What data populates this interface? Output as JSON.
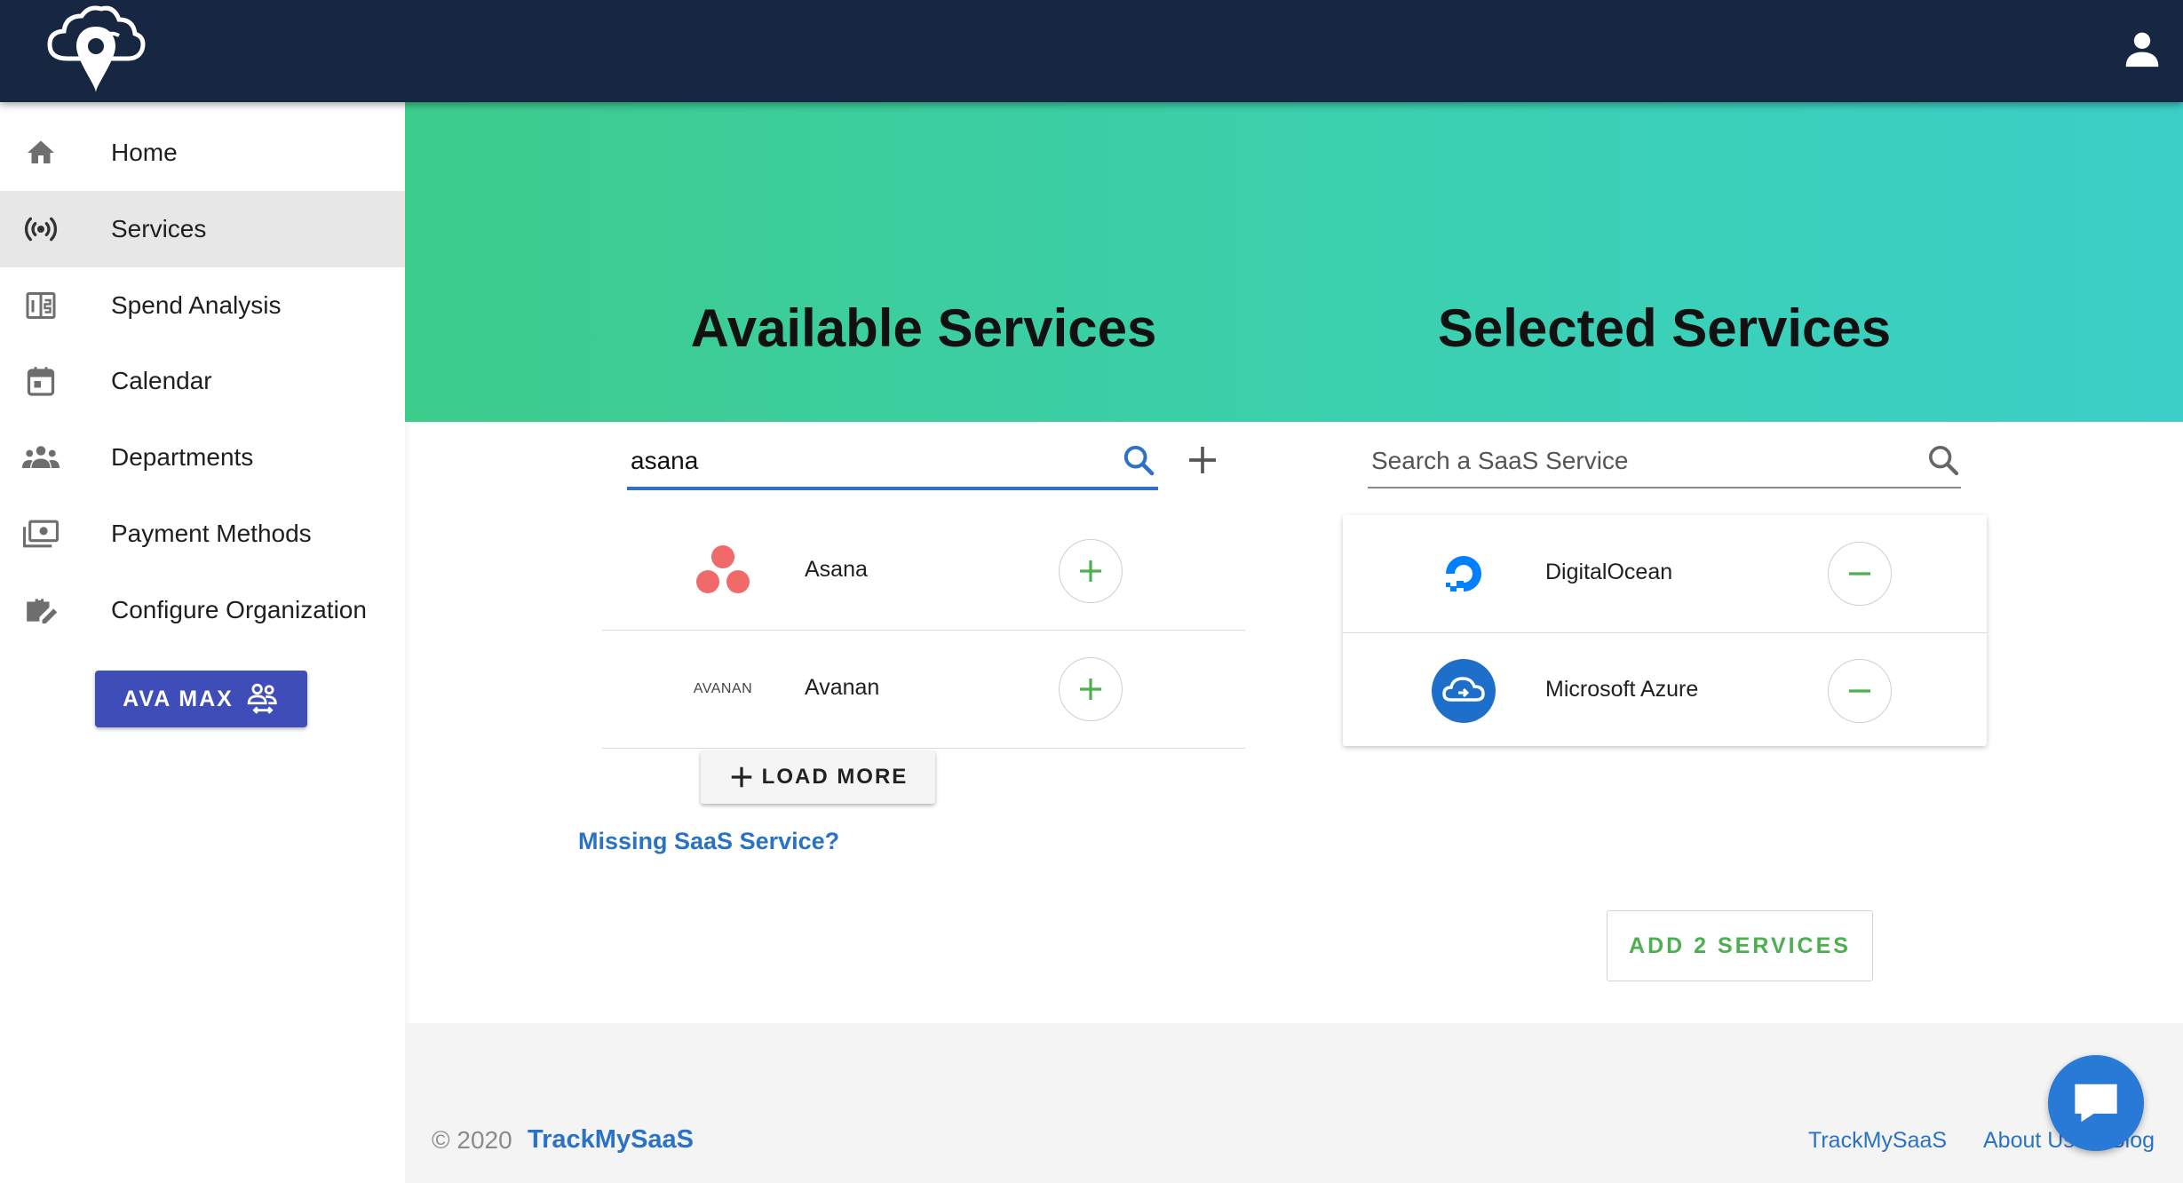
{
  "header": {
    "logo_icon": "cloud-location-logo-icon",
    "user_icon": "user-account-icon",
    "bar_color": "#172641"
  },
  "sidebar": {
    "items": [
      {
        "label": "Home",
        "icon": "home-icon"
      },
      {
        "label": "Services",
        "icon": "broadcast-icon",
        "active": true
      },
      {
        "label": "Spend Analysis",
        "icon": "analysis-icon"
      },
      {
        "label": "Calendar",
        "icon": "calendar-icon"
      },
      {
        "label": "Departments",
        "icon": "people-icon"
      },
      {
        "label": "Payment Methods",
        "icon": "payment-icon"
      },
      {
        "label": "Configure Organization",
        "icon": "briefcase-edit-icon"
      }
    ],
    "ava_button": {
      "label": "AVA MAX",
      "icon": "people-swap-icon",
      "color": "#3f4db8"
    }
  },
  "hero": {
    "available_title": "Available Services",
    "selected_title": "Selected Services"
  },
  "available": {
    "search_value": "asana",
    "services": [
      {
        "name": "Asana",
        "logo_text": ""
      },
      {
        "name": "Avanan",
        "logo_text": "AVANAN"
      }
    ],
    "load_more_label": "LOAD MORE",
    "missing_link": "Missing SaaS Service?"
  },
  "selected": {
    "search_placeholder": "Search a SaaS Service",
    "services": [
      {
        "name": "DigitalOcean"
      },
      {
        "name": "Microsoft Azure"
      }
    ],
    "add_button_label": "ADD 2 SERVICES"
  },
  "footer": {
    "copyright": "© 2020",
    "brand": "TrackMySaaS",
    "links": [
      "TrackMySaaS",
      "About Us",
      "Blog"
    ]
  },
  "colors": {
    "accent_blue": "#2a72c6",
    "add_green": "#4caf50",
    "hero_start": "#3ccc8c",
    "hero_end": "#3bcfc8"
  }
}
